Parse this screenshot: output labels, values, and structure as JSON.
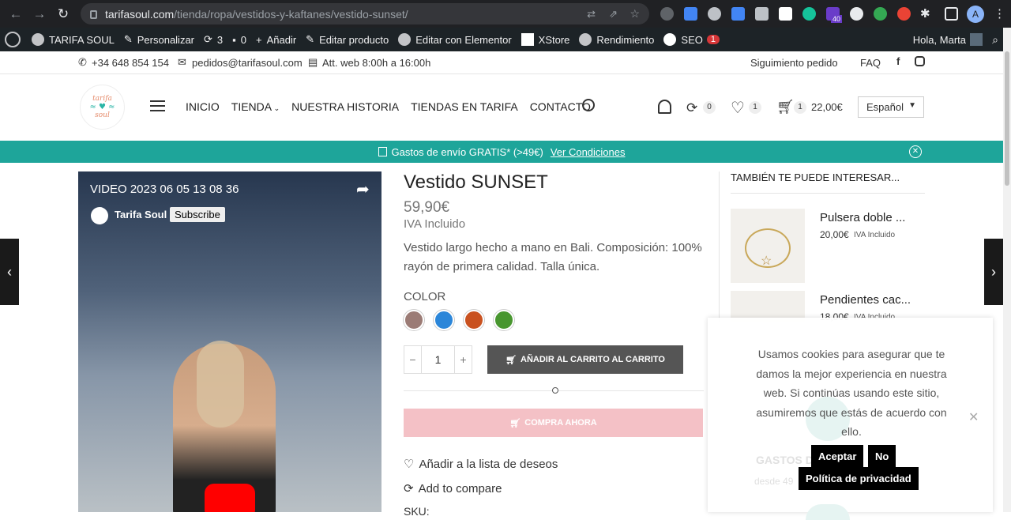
{
  "browser": {
    "url_host": "tarifasoul.com",
    "url_path": "/tienda/ropa/vestidos-y-kaftanes/vestido-sunset/",
    "ext_badge": "40",
    "profile_initial": "A"
  },
  "wpbar": {
    "site": "TARIFA SOUL",
    "customize": "Personalizar",
    "updates": "3",
    "comments": "0",
    "add": "Añadir",
    "edit_product": "Editar producto",
    "elementor": "Editar con Elementor",
    "xstore": "XStore",
    "performance": "Rendimiento",
    "seo": "SEO",
    "seo_badge": "1",
    "greeting": "Hola, Marta"
  },
  "topinfo": {
    "phone": "+34 648 854 154",
    "email": "pedidos@tarifasoul.com",
    "hours": "Att. web 8:00h a 16:00h",
    "tracking": "Siguimiento pedido",
    "faq": "FAQ"
  },
  "header": {
    "logo_top": "tarifa",
    "logo_bottom": "soul",
    "menu": [
      "INICIO",
      "TIENDA",
      "NUESTRA HISTORIA",
      "TIENDAS EN TARIFA",
      "CONTACTO"
    ],
    "compare_count": "0",
    "wishlist_count": "1",
    "cart_count": "1",
    "cart_total": "22,00€",
    "language": "Español"
  },
  "promo": {
    "text": "Gastos de envío GRATIS* (>49€)",
    "link": "Ver Condiciones"
  },
  "video": {
    "title": "VIDEO 2023 06 05 13 08 36",
    "channel": "Tarifa Soul",
    "subscribe": "Subscribe"
  },
  "product": {
    "title": "Vestido SUNSET",
    "price": "59,90€",
    "tax": "IVA Incluido",
    "description": "Vestido largo hecho a mano en Bali. Composición: 100% rayón de primera calidad. Talla única.",
    "color_label": "COLOR",
    "colors": [
      "#9b7b75",
      "#2b86d9",
      "#c9511f",
      "#48962f"
    ],
    "qty": "1",
    "add_to_cart": "AÑADIR AL CARRITO AL CARRITO",
    "buy_now": "COMPRA AHORA",
    "wishlist": "Añadir a la lista de deseos",
    "compare": "Add to compare",
    "sku": "SKU: "
  },
  "related": {
    "heading": "TAMBIÉN TE PUEDE INTERESAR...",
    "items": [
      {
        "name": "Pulsera doble ...",
        "price": "20,00€",
        "tax": "IVA Incluido"
      },
      {
        "name": "Pendientes cac...",
        "price": "18,00€",
        "tax": "IVA Incluido"
      }
    ],
    "shipping": "GASTOS D",
    "shipping_sub": "desde 49"
  },
  "cookie": {
    "text": "Usamos cookies para asegurar que te damos la mejor experiencia en nuestra web. Si continúas usando este sitio, asumiremos que estás de acuerdo con ello.",
    "accept": "Aceptar",
    "reject": "No",
    "privacy": "Política de privacidad"
  }
}
